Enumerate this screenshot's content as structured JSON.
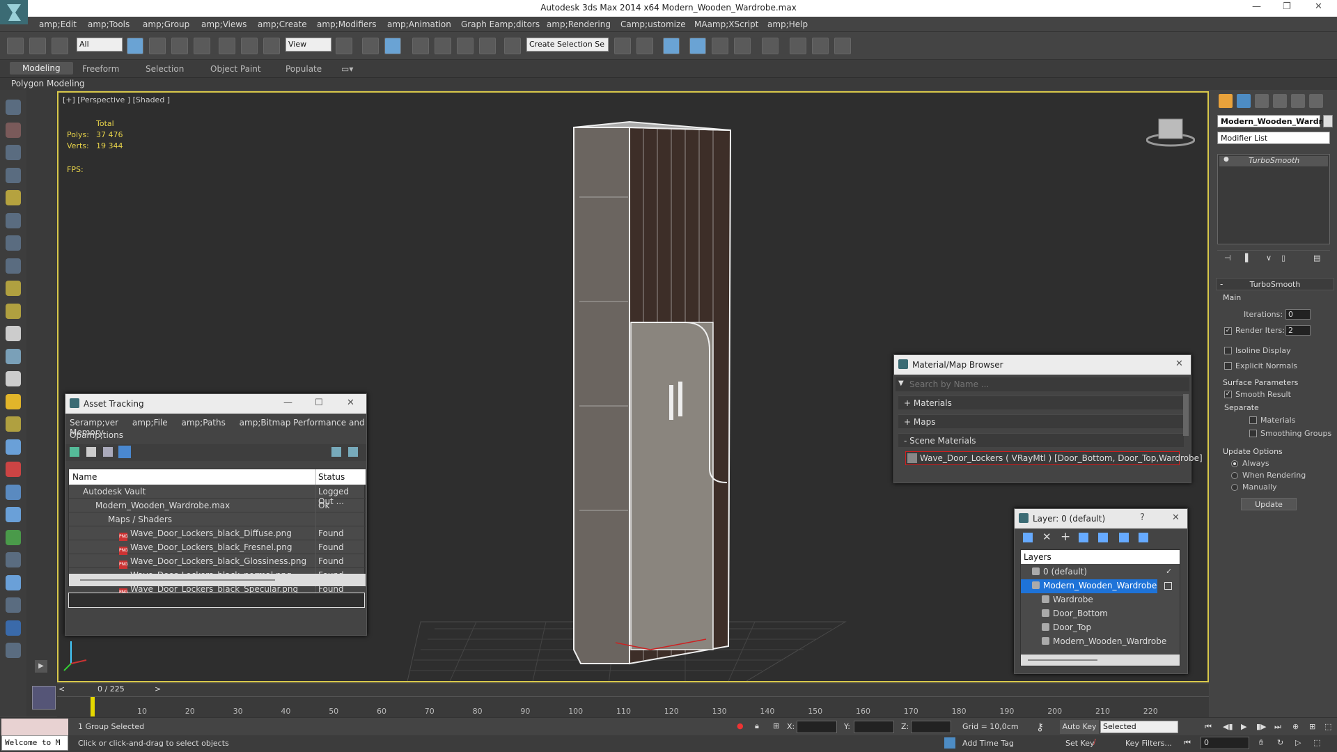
{
  "app": {
    "title": "Autodesk 3ds Max  2014 x64     Modern_Wooden_Wardrobe.max"
  },
  "menu": [
    "amp;Edit",
    "amp;Tools",
    "amp;Group",
    "amp;Views",
    "amp;Create",
    "amp;Modifiers",
    "amp;Animation",
    "Graph Eamp;ditors",
    "amp;Rendering",
    "Camp;ustomize",
    "MAamp;XScript",
    "amp;Help"
  ],
  "toolbar": {
    "selection_filter": "All",
    "reference_coord": "View",
    "named_selection": "Create Selection Se"
  },
  "ribbon": {
    "tabs": [
      "Modeling",
      "Freeform",
      "Selection",
      "Object Paint",
      "Populate"
    ],
    "active": "Modeling",
    "sub_label": "Polygon Modeling"
  },
  "viewport": {
    "label": "[+] [Perspective ] [Shaded ]",
    "stats": {
      "total_label": "Total",
      "polys_label": "Polys:",
      "polys_value": "37 476",
      "verts_label": "Verts:",
      "verts_value": "19 344",
      "fps_label": "FPS:"
    }
  },
  "command_panel": {
    "object_name": "Modern_Wooden_Wardro",
    "modifier_list": "Modifier List",
    "stack_item": "TurboSmooth",
    "rollout_title": "TurboSmooth",
    "main_label": "Main",
    "iterations_label": "Iterations:",
    "iterations_value": "0",
    "render_iters_label": "Render Iters:",
    "render_iters_value": "2",
    "isoline": "Isoline Display",
    "explicit_normals": "Explicit Normals",
    "surface_params": "Surface Parameters",
    "smooth_result": "Smooth Result",
    "separate": "Separate",
    "materials": "Materials",
    "smoothing_groups": "Smoothing Groups",
    "update_options": "Update Options",
    "always": "Always",
    "when_rendering": "When Rendering",
    "manually": "Manually",
    "update_button": "Update"
  },
  "asset_tracking": {
    "title": "Asset Tracking",
    "menu1": [
      "Seramp;ver",
      "amp;File",
      "amp;Paths",
      "amp;Bitmap Performance and Memory"
    ],
    "menu2": "Opamp;tions",
    "col_name": "Name",
    "col_status": "Status",
    "rows": [
      {
        "name": "Autodesk Vault",
        "status": "Logged Out ..."
      },
      {
        "name": "Modern_Wooden_Wardrobe.max",
        "status": "Ok"
      },
      {
        "name": "Maps / Shaders",
        "status": ""
      },
      {
        "name": "Wave_Door_Lockers_black_Diffuse.png",
        "status": "Found"
      },
      {
        "name": "Wave_Door_Lockers_black_Fresnel.png",
        "status": "Found"
      },
      {
        "name": "Wave_Door_Lockers_black_Glossiness.png",
        "status": "Found"
      },
      {
        "name": "Wave_Door_Lockers_black_normal.png",
        "status": "Found"
      },
      {
        "name": "Wave_Door_Lockers_black_Specular.png",
        "status": "Found"
      }
    ],
    "file_badge": "PNG"
  },
  "material_browser": {
    "title": "Material/Map Browser",
    "search_placeholder": "Search by Name ...",
    "materials": "+ Materials",
    "maps": "+ Maps",
    "scene_materials": "- Scene Materials",
    "scene_item": "Wave_Door_Lockers  ( VRayMtl ) [Door_Bottom, Door_Top,Wardrobe]"
  },
  "layer_manager": {
    "title": "Layer: 0 (default)",
    "header": "Layers",
    "rows": [
      {
        "name": "0 (default)",
        "indent": 1
      },
      {
        "name": "Modern_Wooden_Wardrobe",
        "indent": 1
      },
      {
        "name": "Wardrobe",
        "indent": 2
      },
      {
        "name": "Door_Bottom",
        "indent": 2
      },
      {
        "name": "Door_Top",
        "indent": 2
      },
      {
        "name": "Modern_Wooden_Wardrobe",
        "indent": 2
      }
    ]
  },
  "timeline": {
    "frame": "0 / 225",
    "ticks": [
      "10",
      "20",
      "30",
      "40",
      "50",
      "60",
      "70",
      "80",
      "90",
      "100",
      "110",
      "120",
      "130",
      "140",
      "150",
      "160",
      "170",
      "180",
      "190",
      "200",
      "210",
      "220"
    ]
  },
  "status": {
    "maxscript": "Welcome to M",
    "selection": "1 Group Selected",
    "prompt": "Click or click-and-drag to select objects",
    "x_label": "X:",
    "y_label": "Y:",
    "z_label": "Z:",
    "grid": "Grid = 10,0cm",
    "add_time_tag": "Add Time Tag",
    "auto_key": "Auto Key",
    "set_key": "Set Key",
    "selected": "Selected",
    "key_filters": "Key Filters...",
    "frame_field": "0"
  },
  "colors": {
    "viewport_border": "#d8c84a",
    "stats_text": "#e7d34a",
    "selection_blue": "#1e73d8",
    "highlight_red": "#cc1f1f"
  }
}
